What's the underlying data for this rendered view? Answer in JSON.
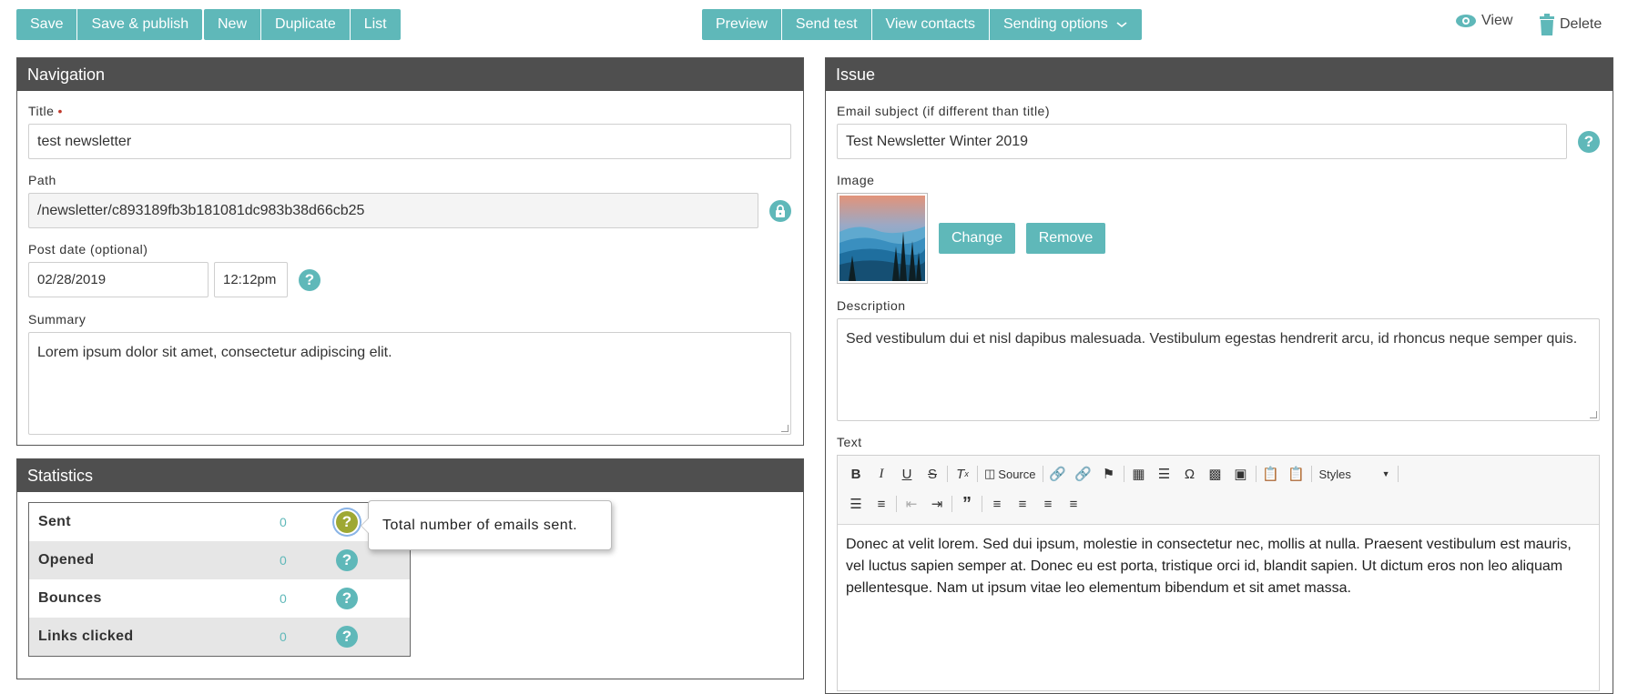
{
  "toolbar": {
    "group1": [
      "Save",
      "Save & publish"
    ],
    "group2": [
      "New",
      "Duplicate",
      "List"
    ],
    "group3": [
      "Preview",
      "Send test",
      "View contacts",
      "Sending options"
    ],
    "view_label": "View",
    "delete_label": "Delete"
  },
  "navigation": {
    "header": "Navigation",
    "title_label": "Title",
    "required_mark": "•",
    "title_value": "test newsletter",
    "path_label": "Path",
    "path_value": "/newsletter/c893189fb3b181081dc983b38d66cb25",
    "postdate_label": "Post date (optional)",
    "date_value": "02/28/2019",
    "time_value": "12:12pm",
    "summary_label": "Summary",
    "summary_value": "Lorem ipsum dolor sit amet, consectetur adipiscing elit."
  },
  "statistics": {
    "header": "Statistics",
    "rows": [
      {
        "name": "Sent",
        "value": "0"
      },
      {
        "name": "Opened",
        "value": "0"
      },
      {
        "name": "Bounces",
        "value": "0"
      },
      {
        "name": "Links clicked",
        "value": "0"
      }
    ],
    "tooltip": "Total number of emails sent."
  },
  "issue": {
    "header": "Issue",
    "subject_label": "Email subject (if different than title)",
    "subject_value": "Test Newsletter Winter 2019",
    "image_label": "Image",
    "change_label": "Change",
    "remove_label": "Remove",
    "description_label": "Description",
    "description_value": "Sed vestibulum dui et nisl dapibus malesuada. Vestibulum egestas hendrerit arcu, id rhoncus neque semper quis.",
    "text_label": "Text",
    "source_label": "Source",
    "styles_label": "Styles",
    "text_value": "Donec at velit lorem. Sed dui ipsum, molestie in consectetur nec, mollis at nulla. Praesent vestibulum est mauris, vel luctus sapien semper at. Donec eu est porta, tristique orci id, blandit sapien. Ut dictum eros non leo aliquam pellentesque. Nam ut ipsum vitae leo elementum bibendum et sit amet massa."
  },
  "colors": {
    "accent": "#5fb8b9",
    "panel_header": "#4f4f4f",
    "active_help": "#9ea833"
  }
}
